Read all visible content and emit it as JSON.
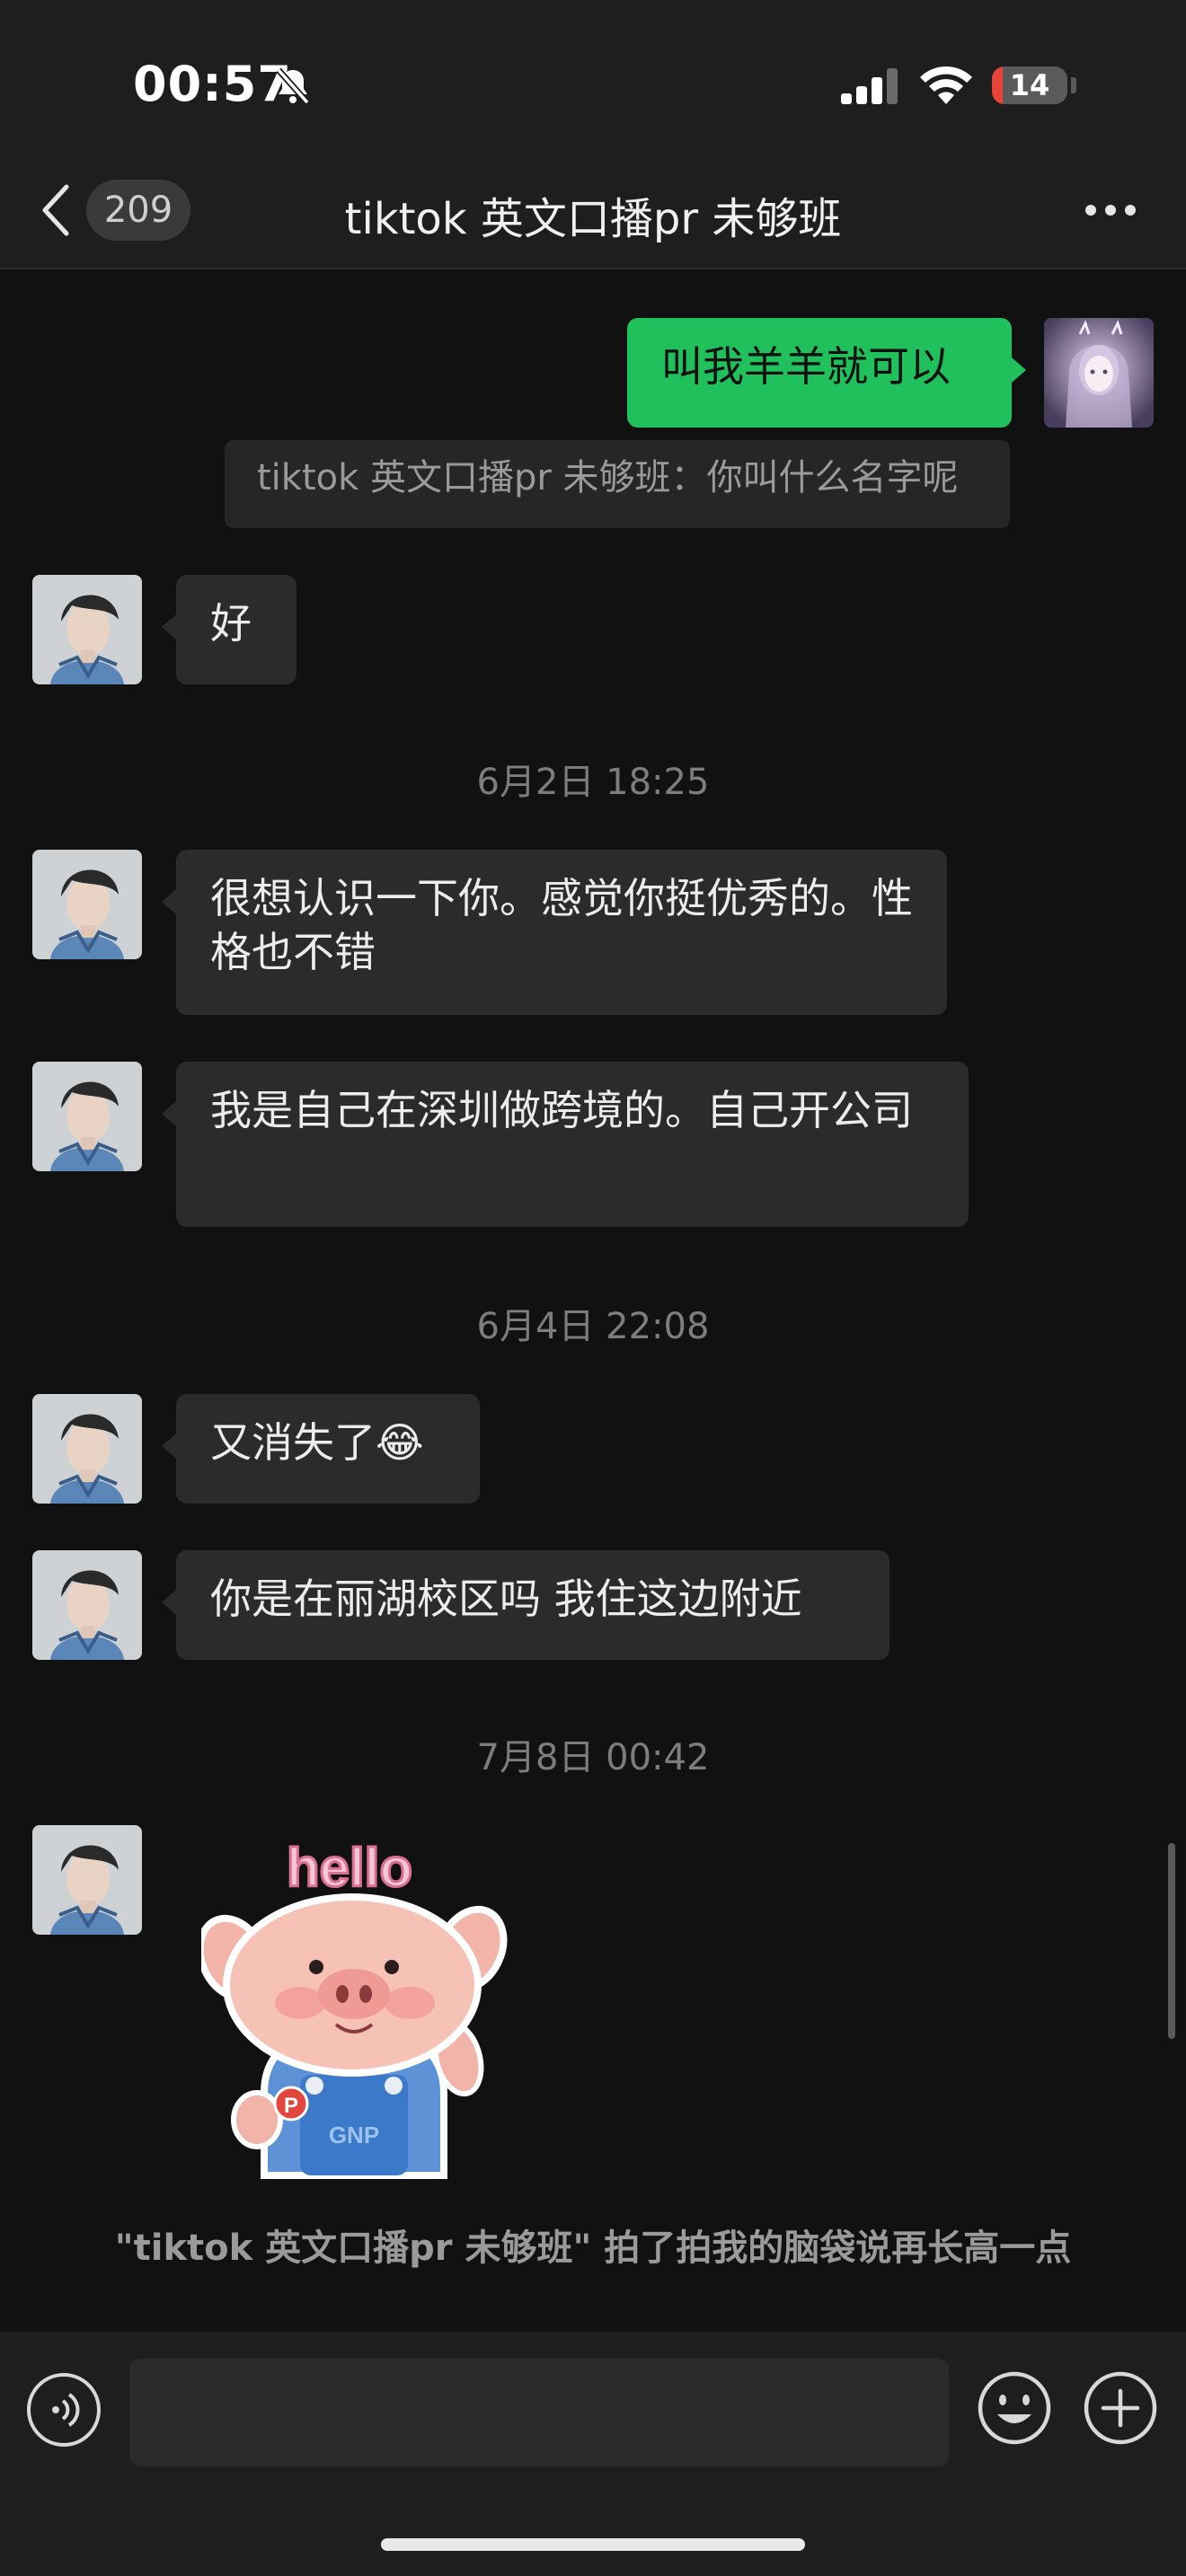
{
  "status_bar": {
    "time": "00:57",
    "battery_percent": "14",
    "battery_level": 0.14,
    "silent_icon": "bell-slash-icon",
    "signal_icon": "cellular-signal-icon",
    "wifi_icon": "wifi-icon"
  },
  "header": {
    "back_icon": "chevron-left-icon",
    "unread_count": "209",
    "title": "tiktok 英文口播pr 未够班",
    "more_icon": "ellipsis-icon"
  },
  "messages": [
    {
      "type": "outgoing",
      "text": "叫我羊羊就可以"
    },
    {
      "type": "quote",
      "text": "tiktok 英文口播pr 未够班：你叫什么名字呢"
    },
    {
      "type": "incoming",
      "text": "好"
    },
    {
      "type": "time",
      "text": "6月2日 18:25"
    },
    {
      "type": "incoming",
      "text": "很想认识一下你。感觉你挺优秀的。性格也不错"
    },
    {
      "type": "incoming",
      "text": "我是自己在深圳做跨境的。自己开公司"
    },
    {
      "type": "time",
      "text": "6月4日 22:08"
    },
    {
      "type": "incoming",
      "text": "又消失了😂"
    },
    {
      "type": "incoming",
      "text": "你是在丽湖校区吗 我住这边附近"
    },
    {
      "type": "time",
      "text": "7月8日 00:42"
    },
    {
      "type": "sticker",
      "caption": "hello",
      "badge": "P",
      "overalls_text": "GNP"
    },
    {
      "type": "system",
      "text": "\"tiktok 英文口播pr 未够班\" 拍了拍我的脑袋说再长高一点"
    }
  ],
  "input_bar": {
    "voice_icon": "voice-icon",
    "text_value": "",
    "emoji_icon": "emoji-icon",
    "plus_icon": "plus-circle-icon"
  },
  "colors": {
    "background": "#111111",
    "bar": "#1e1e1e",
    "incoming_bubble": "#2b2b2b",
    "outgoing_bubble": "#20c05c",
    "battery_low": "#e8443a"
  }
}
